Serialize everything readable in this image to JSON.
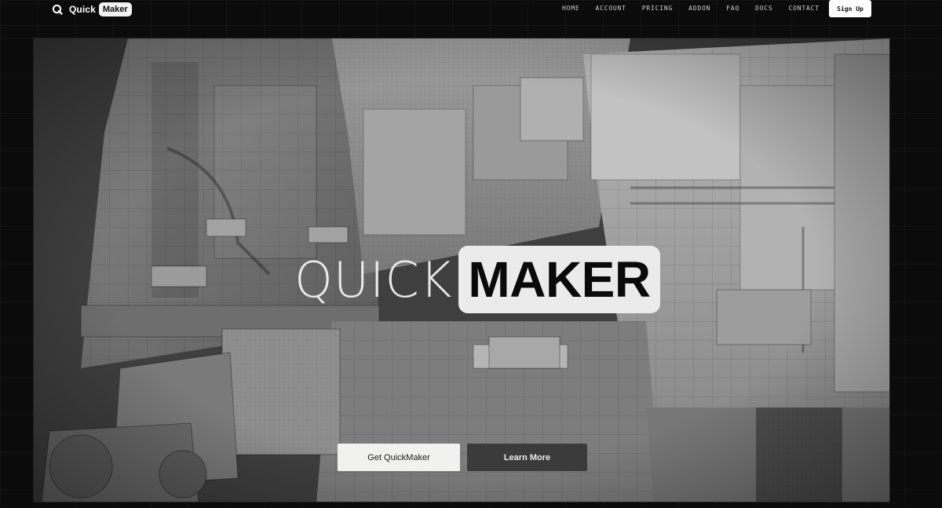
{
  "brand": {
    "quick": "Quick",
    "maker": "Maker",
    "icon": "q-logo-icon"
  },
  "nav": {
    "links": [
      "HOME",
      "ACCOUNT",
      "PRICING",
      "ADDON",
      "FAQ",
      "DOCS",
      "CONTACT"
    ],
    "signup_label": "Sign Up"
  },
  "hero": {
    "title_light": "QUICK",
    "title_bold": "MAKER",
    "primary_cta": "Get QuickMaker",
    "secondary_cta": "Learn More",
    "background": "sci-fi-megastructure-render"
  },
  "colors": {
    "page_bg": "#0b0b0c",
    "button_light": "#f1f1ef",
    "button_dark": "#3b3b3c"
  }
}
